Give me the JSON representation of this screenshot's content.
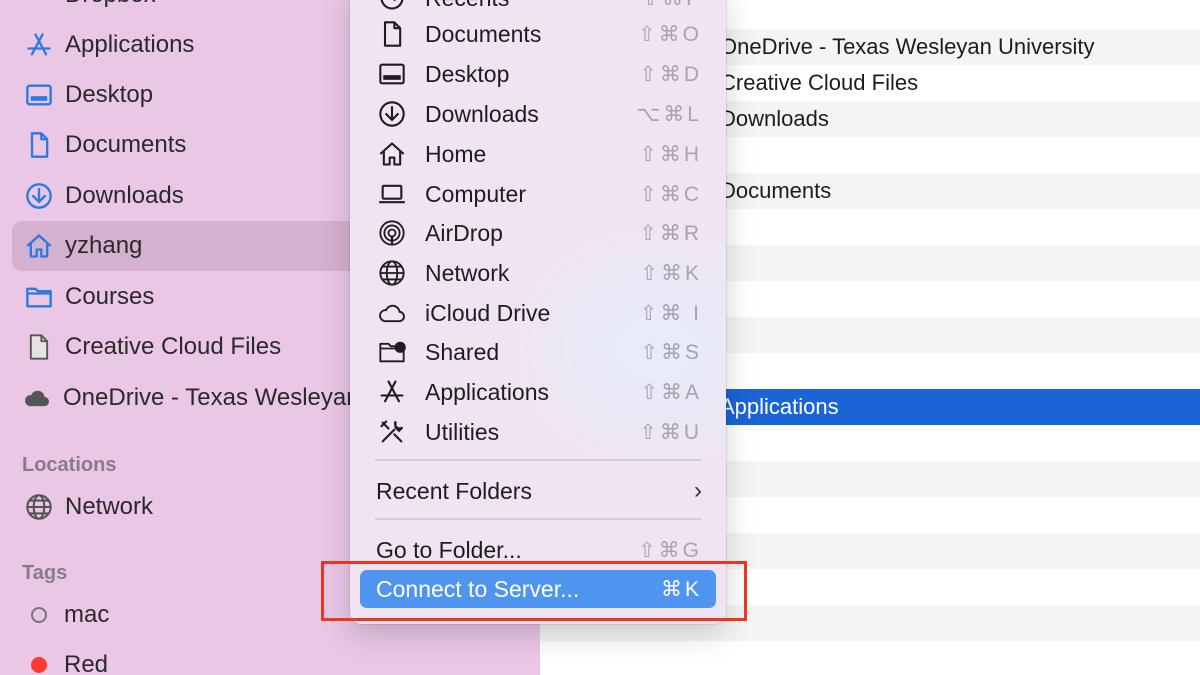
{
  "sidebar": {
    "top_partial": "Dropbox",
    "favorites": [
      {
        "label": "Applications",
        "icon": "applications-icon"
      },
      {
        "label": "Desktop",
        "icon": "desktop-icon"
      },
      {
        "label": "Documents",
        "icon": "document-icon"
      },
      {
        "label": "Downloads",
        "icon": "downloads-icon"
      },
      {
        "label": "yzhang",
        "icon": "home-icon",
        "selected": true
      },
      {
        "label": "Courses",
        "icon": "folder-icon"
      },
      {
        "label": "Creative Cloud Files",
        "icon": "file-icon"
      },
      {
        "label": "OneDrive - Texas Wesleyan University",
        "icon": "cloud-icon"
      }
    ],
    "locations_header": "Locations",
    "locations": [
      {
        "label": "Network",
        "icon": "network-icon"
      }
    ],
    "tags_header": "Tags",
    "tags": [
      {
        "label": "mac",
        "color": ""
      },
      {
        "label": "Red",
        "color": "#ff3b30"
      }
    ]
  },
  "file_list": {
    "rows": [
      {
        "text": "",
        "alt": false
      },
      {
        "text": "OneDrive - Texas Wesleyan University",
        "alt": true
      },
      {
        "text": "Creative Cloud Files",
        "alt": false
      },
      {
        "text": "Downloads",
        "alt": true
      },
      {
        "text": "",
        "alt": false
      },
      {
        "text": "Documents",
        "alt": true
      },
      {
        "text": "",
        "alt": false
      },
      {
        "text": "",
        "alt": true
      },
      {
        "text": "",
        "alt": false
      },
      {
        "text": "",
        "alt": true
      },
      {
        "text": "",
        "alt": false
      },
      {
        "text": "Applications",
        "selected": true
      },
      {
        "text": "",
        "alt": false
      },
      {
        "text": "",
        "alt": true
      },
      {
        "text": "",
        "alt": false
      },
      {
        "text": "",
        "alt": true
      },
      {
        "text": "",
        "alt": false
      },
      {
        "text": "",
        "alt": true
      }
    ]
  },
  "go_menu": {
    "items": [
      {
        "label": "Recents",
        "shortcut": "⇧⌘F",
        "icon": "recents-icon"
      },
      {
        "label": "Documents",
        "shortcut": "⇧⌘O",
        "icon": "document-icon"
      },
      {
        "label": "Desktop",
        "shortcut": "⇧⌘D",
        "icon": "desktop-icon"
      },
      {
        "label": "Downloads",
        "shortcut": "⌥⌘L",
        "icon": "downloads-icon"
      },
      {
        "label": "Home",
        "shortcut": "⇧⌘H",
        "icon": "home-icon"
      },
      {
        "label": "Computer",
        "shortcut": "⇧⌘C",
        "icon": "computer-icon"
      },
      {
        "label": "AirDrop",
        "shortcut": "⇧⌘R",
        "icon": "airdrop-icon"
      },
      {
        "label": "Network",
        "shortcut": "⇧⌘K",
        "icon": "network-icon"
      },
      {
        "label": "iCloud Drive",
        "shortcut": "⇧⌘ I",
        "icon": "icloud-icon"
      },
      {
        "label": "Shared",
        "shortcut": "⇧⌘S",
        "icon": "shared-folder-icon"
      },
      {
        "label": "Applications",
        "shortcut": "⇧⌘A",
        "icon": "applications-icon"
      },
      {
        "label": "Utilities",
        "shortcut": "⇧⌘U",
        "icon": "utilities-icon"
      }
    ],
    "recent_folders": "Recent Folders",
    "go_to_folder": {
      "label": "Go to Folder...",
      "shortcut": "⇧⌘G"
    },
    "connect_to_server": {
      "label": "Connect to Server...",
      "shortcut": "⌘K"
    }
  },
  "colors": {
    "sidebar_bg": "#e9c7e5",
    "selection_blue": "#1b64d6",
    "menu_highlight": "#4f95f0",
    "callout_red": "#e8381f"
  }
}
